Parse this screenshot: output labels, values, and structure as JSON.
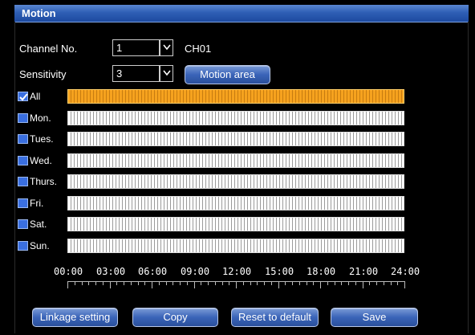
{
  "window": {
    "title": "Motion"
  },
  "channel": {
    "label": "Channel No.",
    "value": "1",
    "name": "CH01"
  },
  "sensitivity": {
    "label": "Sensitivity",
    "value": "3"
  },
  "motion_area_button": "Motion area",
  "days": [
    {
      "label": "All",
      "checked": true
    },
    {
      "label": "Mon.",
      "checked": false
    },
    {
      "label": "Tues.",
      "checked": false
    },
    {
      "label": "Wed.",
      "checked": false
    },
    {
      "label": "Thurs.",
      "checked": false
    },
    {
      "label": "Fri.",
      "checked": false
    },
    {
      "label": "Sat.",
      "checked": false
    },
    {
      "label": "Sun.",
      "checked": false
    }
  ],
  "time_ticks": [
    "00:00",
    "03:00",
    "06:00",
    "09:00",
    "12:00",
    "15:00",
    "18:00",
    "21:00",
    "24:00"
  ],
  "buttons": {
    "linkage": "Linkage setting",
    "copy": "Copy",
    "reset": "Reset to default",
    "save": "Save"
  },
  "colors": {
    "title_bar": "#2f5fb5",
    "selected_schedule": "#f6a21e",
    "button": "#3a64b8"
  }
}
